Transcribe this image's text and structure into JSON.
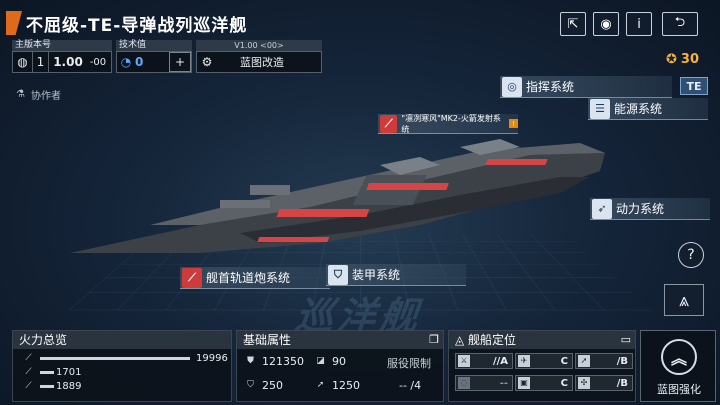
{
  "header": {
    "title": "不屈级-TE-导弹战列巡洋舰",
    "share_icon": "share-icon",
    "view_icon": "eye-icon",
    "info_label": "i",
    "back_icon": "back-icon"
  },
  "version": {
    "main_label": "主版本号",
    "main_num": "1",
    "main_value": "1.00",
    "main_suffix": "-00",
    "tech_label": "技术值",
    "tech_value": "0",
    "blueprint_version": "V1.00 <00>",
    "blueprint_mod_label": "蓝图改造"
  },
  "collaborator_label": "协作者",
  "currency": {
    "value": "30",
    "icon": "coin-icon"
  },
  "systems": {
    "command": "指挥系统",
    "te_badge": "TE",
    "energy": "能源系统",
    "missile": "\"凛冽寒风\"MK2-火箭发射系统",
    "power": "动力系统",
    "bow_cannon": "舰首轨道炮系统",
    "armor": "装甲系统"
  },
  "help_label": "?",
  "firepower": {
    "title": "火力总览",
    "rows": [
      {
        "value": "19996",
        "fraction": 1.0
      },
      {
        "value": "1701",
        "fraction": 0.09
      },
      {
        "value": "1889",
        "fraction": 0.09
      }
    ]
  },
  "attributes": {
    "title": "基础属性",
    "hp": "121350",
    "armor": "90",
    "speed": "250",
    "evasion": "1250",
    "service_label": "服役限制",
    "service_value": "-- /4"
  },
  "positioning": {
    "title": "舰船定位",
    "cells": [
      {
        "grade": "//A"
      },
      {
        "grade": "C"
      },
      {
        "grade": "/B"
      },
      {
        "grade": "--"
      },
      {
        "grade": "C"
      },
      {
        "grade": "/B"
      }
    ]
  },
  "enhance": {
    "label": "蓝图强化",
    "icon": "chevron-up-icon"
  },
  "colors": {
    "accent_orange": "#e06a1c",
    "panel_bg": "#0c121a",
    "red_highlight": "#cf3a3a"
  }
}
